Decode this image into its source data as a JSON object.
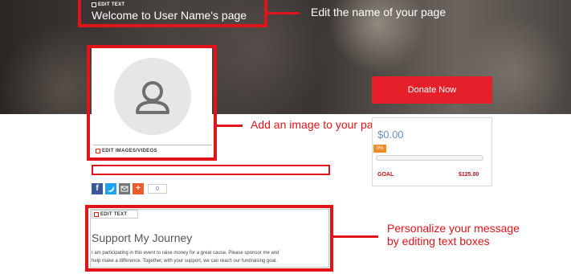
{
  "header": {
    "edit_label": "EDIT TEXT",
    "title": "Welcome to User Name's page"
  },
  "photo": {
    "edit_label": "EDIT IMAGES/VIDEOS",
    "icon": "user-avatar-icon"
  },
  "donate": {
    "button_label": "Donate Now",
    "raised": "$0.00",
    "progress_label": "0%",
    "progress_fraction": 0,
    "goal_label": "GOAL",
    "goal_amount": "$125.00"
  },
  "share": {
    "icons": [
      "facebook-icon",
      "twitter-icon",
      "email-icon",
      "plus-icon"
    ],
    "count": "0"
  },
  "story": {
    "edit_label": "EDIT TEXT",
    "heading": "Support My Journey",
    "body_line1": "I am participating in this event to raise money for a great cause. Please sponsor me and",
    "body_line2": "help make a difference. Together, with your support, we can reach our fundraising goal."
  },
  "callouts": {
    "name": "Edit the name of your page",
    "image": "Add an image to your page",
    "message_line1": "Personalize your message",
    "message_line2": "by editing text boxes"
  },
  "colors": {
    "accent": "#e2141b",
    "progress": "#f08a24",
    "raised": "#6a8fc6"
  }
}
